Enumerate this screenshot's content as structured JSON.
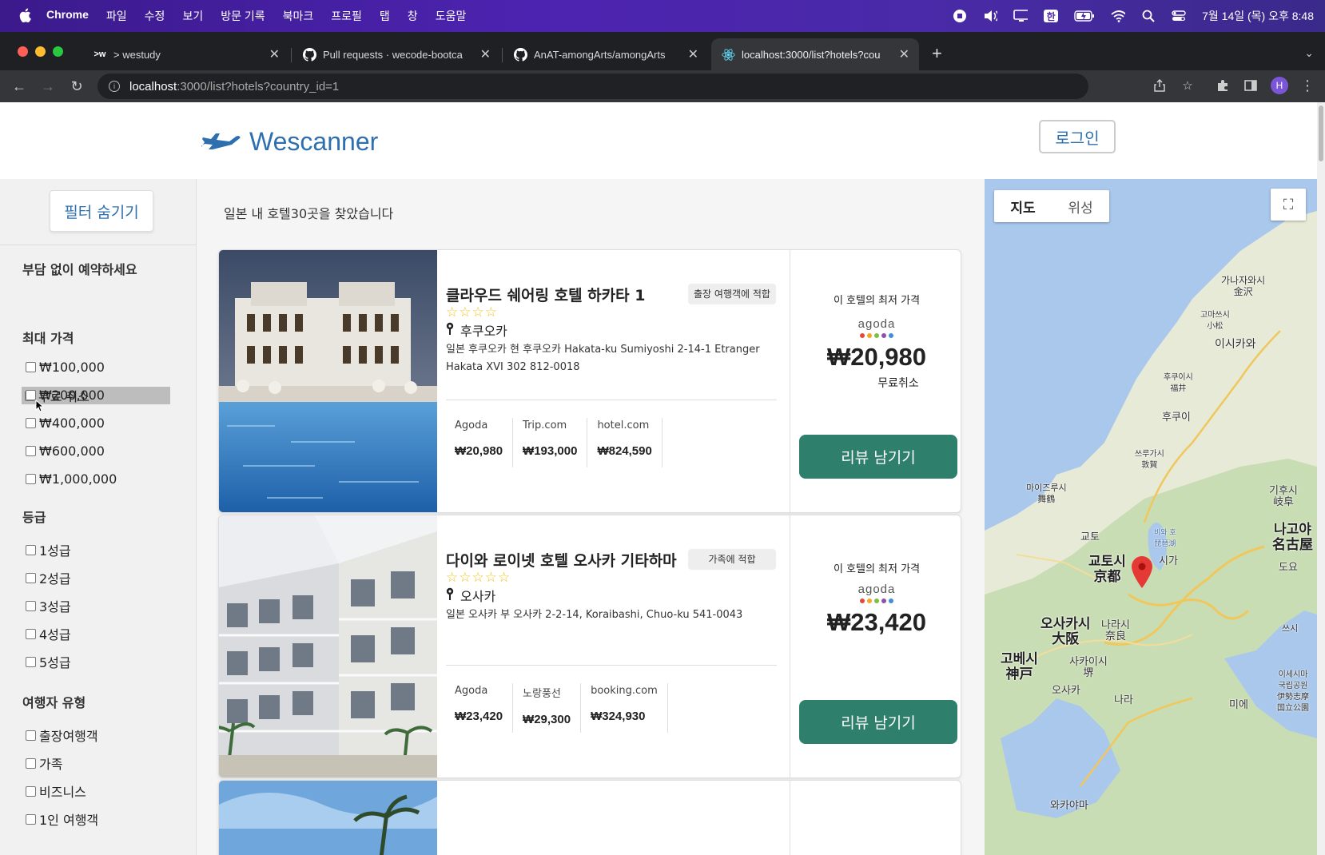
{
  "mac_menubar": {
    "app_name": "Chrome",
    "menus": [
      "파일",
      "수정",
      "보기",
      "방문 기록",
      "북마크",
      "프로필",
      "탭",
      "창",
      "도움말"
    ],
    "ime_label": "한",
    "clock": "7월 14일 (목) 오후 8:48"
  },
  "browser": {
    "tabs": [
      {
        "icon": ">w",
        "title": "> westudy"
      },
      {
        "icon": "github-icon",
        "title": "Pull requests · wecode-bootca"
      },
      {
        "icon": "github-icon",
        "title": "AnAT-amongArts/amongArts"
      },
      {
        "icon": "react-icon",
        "title": "localhost:3000/list?hotels?cou"
      }
    ],
    "url_host": "localhost",
    "url_rest": ":3000/list?hotels?country_id=1",
    "profile_initial": "H"
  },
  "header": {
    "logo_text": "Wescanner",
    "login_label": "로그인"
  },
  "sidebar": {
    "toggle_label": "필터 숨기기",
    "section_booking": "부담 없이 예약하세요",
    "free_cancel_label": "무료 취소",
    "section_price": "최대 가격",
    "price_options": [
      "₩100,000",
      "₩200,000",
      "₩400,000",
      "₩600,000",
      "₩1,000,000"
    ],
    "section_grade": "등급",
    "grade_options": [
      "1성급",
      "2성급",
      "3성급",
      "4성급",
      "5성급"
    ],
    "section_traveler": "여행자 유형",
    "traveler_options": [
      "출장여행객",
      "가족",
      "비즈니스",
      "1인 여행객"
    ]
  },
  "results": {
    "summary": "일본 내 호텔30곳을 찾았습니다",
    "hotels": [
      {
        "name": "클라우드 쉐어링 호텔 하카타 1",
        "tag": "출장 여행객에 적합",
        "stars": 4,
        "city": "후쿠오카",
        "address": "일본 후쿠오카 현 후쿠오카 Hakata-ku Sumiyoshi 2-14-1 Etranger Hakata XVI 302 812-0018",
        "prices": [
          {
            "site": "Agoda",
            "price": "₩20,980"
          },
          {
            "site": "Trip.com",
            "price": "₩193,000"
          },
          {
            "site": "hotel.com",
            "price": "₩824,590"
          }
        ],
        "best_label": "이 호텔의 최저 가격",
        "best_site": "agoda",
        "best_price": "₩20,980",
        "best_note": "무료취소",
        "review_label": "리뷰 남기기"
      },
      {
        "name": "다이와 로이넷 호텔 오사카 기타하마",
        "tag": "가족에 적합",
        "stars": 5,
        "city": "오사카",
        "address": "일본 오사카 부 오사카 2-2-14, Koraibashi, Chuo-ku 541-0043",
        "prices": [
          {
            "site": "Agoda",
            "price": "₩23,420"
          },
          {
            "site": "노랑풍선",
            "price": "₩29,300"
          },
          {
            "site": "booking.com",
            "price": "₩324,930"
          }
        ],
        "best_label": "이 호텔의 최저 가격",
        "best_site": "agoda",
        "best_price": "₩23,420",
        "best_note": "",
        "review_label": "리뷰 남기기"
      }
    ]
  },
  "map": {
    "tab_map": "지도",
    "tab_satellite": "위성",
    "labels": [
      {
        "text": "가나자와시\n金沢",
        "big": false
      },
      {
        "text": "고마쓰시\n小松",
        "big": false
      },
      {
        "text": "이시카와",
        "big": false
      },
      {
        "text": "후쿠이시\n福井",
        "big": false
      },
      {
        "text": "후쿠이",
        "big": false
      },
      {
        "text": "쓰루가시\n敦賀",
        "big": false
      },
      {
        "text": "마이즈루시\n舞鶴",
        "big": false
      },
      {
        "text": "기후시\n岐阜",
        "big": false
      },
      {
        "text": "나고야\n名古屋",
        "big": true
      },
      {
        "text": "비와 호\n琵琶湖",
        "big": false
      },
      {
        "text": "교토",
        "big": false
      },
      {
        "text": "교토시\n京都",
        "big": true
      },
      {
        "text": "시가",
        "big": false
      },
      {
        "text": "도요",
        "big": false
      },
      {
        "text": "오사카시\n大阪",
        "big": true
      },
      {
        "text": "나라시\n奈良",
        "big": false
      },
      {
        "text": "고베시\n神戸",
        "big": true
      },
      {
        "text": "사카이시\n堺",
        "big": false
      },
      {
        "text": "오사카",
        "big": false
      },
      {
        "text": "나라",
        "big": false
      },
      {
        "text": "미에",
        "big": false
      },
      {
        "text": "이세시마\n국립공원\n伊勢志摩\n国立公園",
        "big": false
      },
      {
        "text": "와카야마",
        "big": false
      },
      {
        "text": "쓰시",
        "big": false
      }
    ]
  }
}
